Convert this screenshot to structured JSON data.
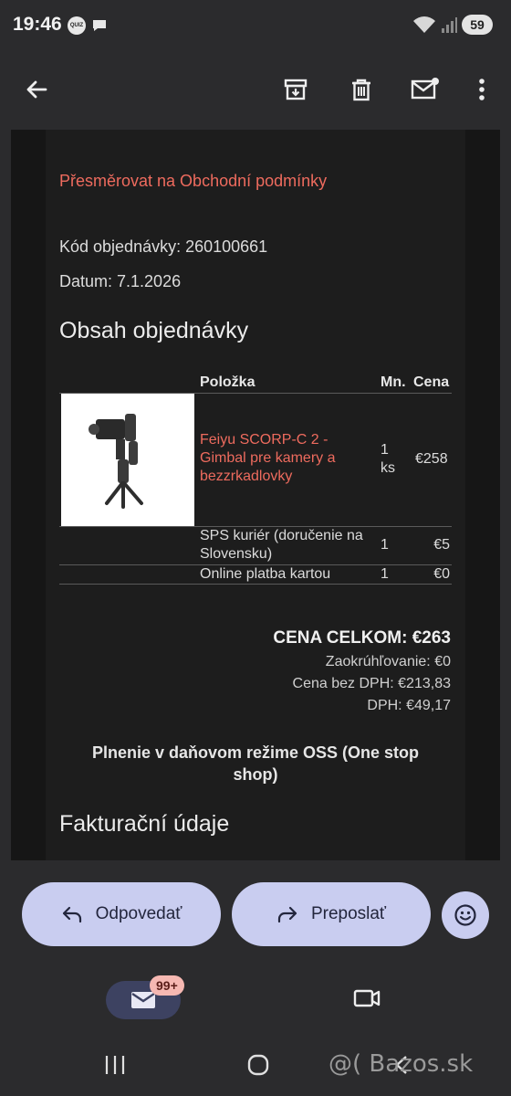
{
  "status": {
    "time": "19:46",
    "quiz_label": "QUIZ",
    "battery": "59"
  },
  "toolbar": {
    "back_icon": "arrow-left-icon",
    "archive_icon": "archive-icon",
    "delete_icon": "trash-icon",
    "mark_unread_icon": "mail-unread-icon",
    "more_icon": "more-vert-icon"
  },
  "email": {
    "terms_link": "Přesměrovat na Obchodní podmínky",
    "order_code": "Kód objednávky: 260100661",
    "date": "Datum: 7.1.2026",
    "order_heading": "Obsah objednávky",
    "table": {
      "headers": [
        "Položka",
        "Mn.",
        "Cena"
      ],
      "rows": [
        {
          "item_lines": [
            "Feiyu SCORP-C 2 -",
            "Gimbal pre kamery a",
            "bezzrkadlovky"
          ],
          "qty_lines": [
            "1",
            "ks"
          ],
          "price": "€258",
          "has_image": true
        },
        {
          "item_lines": [
            "SPS kuriér (doručenie na",
            "Slovensku)"
          ],
          "qty_lines": [
            "1"
          ],
          "price": "€5"
        },
        {
          "item_lines": [
            "Online platba kartou"
          ],
          "qty_lines": [
            "1"
          ],
          "price": "€0"
        }
      ]
    },
    "total": "CENA CELKOM: €263",
    "rounding": "Zaokrúhľovanie: €0",
    "net": "Cena bez DPH: €213,83",
    "vat": "DPH: €49,17",
    "oss_line1": "Plnenie v daňovom režime OSS (One stop",
    "oss_line2": "shop)",
    "billing_heading": "Fakturační údaje"
  },
  "actions": {
    "reply": "Odpovedať",
    "forward": "Preposlať"
  },
  "bottom_nav": {
    "mail_badge": "99+"
  },
  "watermark": "@( Bazos.sk",
  "colors": {
    "accent_link": "#ee6b5e",
    "pill_bg": "#c9cdf0",
    "badge_bg": "#f6b8b2"
  }
}
